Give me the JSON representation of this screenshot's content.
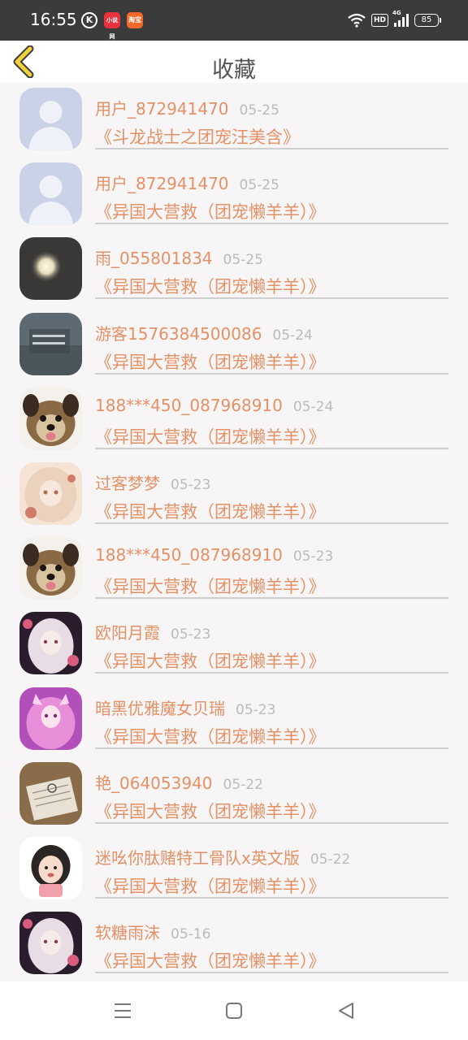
{
  "status_bar": {
    "time": "16:55",
    "icons": [
      "k-icon",
      "app-badge-icon",
      "app-badge-icon",
      "wifi-icon",
      "hd-icon",
      "signal-4g-icon",
      "battery-icon"
    ],
    "app_badge_1": "小说网",
    "app_badge_2": "淘宝",
    "hd": "HD",
    "network": "4G",
    "battery": "85"
  },
  "header": {
    "title": "收藏",
    "back_icon": "chevron-left-icon"
  },
  "items": [
    {
      "user": "用户_872941470",
      "date": "05-25",
      "work": "《斗龙战士之团宠汪美含》",
      "avatar": "default"
    },
    {
      "user": "用户_872941470",
      "date": "05-25",
      "work": "《异国大营救（团宠懒羊羊）》",
      "avatar": "default"
    },
    {
      "user": "雨_055801834",
      "date": "05-25",
      "work": "《异国大营救（团宠懒羊羊）》",
      "avatar": "moon"
    },
    {
      "user": "游客1576384500086",
      "date": "05-24",
      "work": "《异国大营救（团宠懒羊羊）》",
      "avatar": "gray"
    },
    {
      "user": "188***450_087968910",
      "date": "05-24",
      "work": "《异国大营救（团宠懒羊羊）》",
      "avatar": "dog"
    },
    {
      "user": "过客梦梦",
      "date": "05-23",
      "work": "《异国大营救（团宠懒羊羊）》",
      "avatar": "anime-light"
    },
    {
      "user": "188***450_087968910",
      "date": "05-23",
      "work": "《异国大营救（团宠懒羊羊）》",
      "avatar": "dog"
    },
    {
      "user": "欧阳月霞",
      "date": "05-23",
      "work": "《异国大营救（团宠懒羊羊）》",
      "avatar": "anime-dark"
    },
    {
      "user": "暗黑优雅魔女贝瑞",
      "date": "05-23",
      "work": "《异国大营救（团宠懒羊羊）》",
      "avatar": "anime-pink"
    },
    {
      "user": "艳_064053940",
      "date": "05-22",
      "work": "《异国大营救（团宠懒羊羊）》",
      "avatar": "paper"
    },
    {
      "user": "迷吆你肽赌特工骨队x英文版",
      "date": "05-22",
      "work": "《异国大营救（团宠懒羊羊）》",
      "avatar": "cartoon"
    },
    {
      "user": "软糖雨沫",
      "date": "05-16",
      "work": "《异国大营救（团宠懒羊羊）》",
      "avatar": "anime-dark"
    }
  ],
  "nav_bar": {
    "buttons": [
      "menu-icon",
      "home-square-icon",
      "back-triangle-icon"
    ]
  },
  "colors": {
    "accent": "#e49165",
    "date": "#bbbbbb",
    "title": "#555555",
    "back": "#f2d23a"
  }
}
